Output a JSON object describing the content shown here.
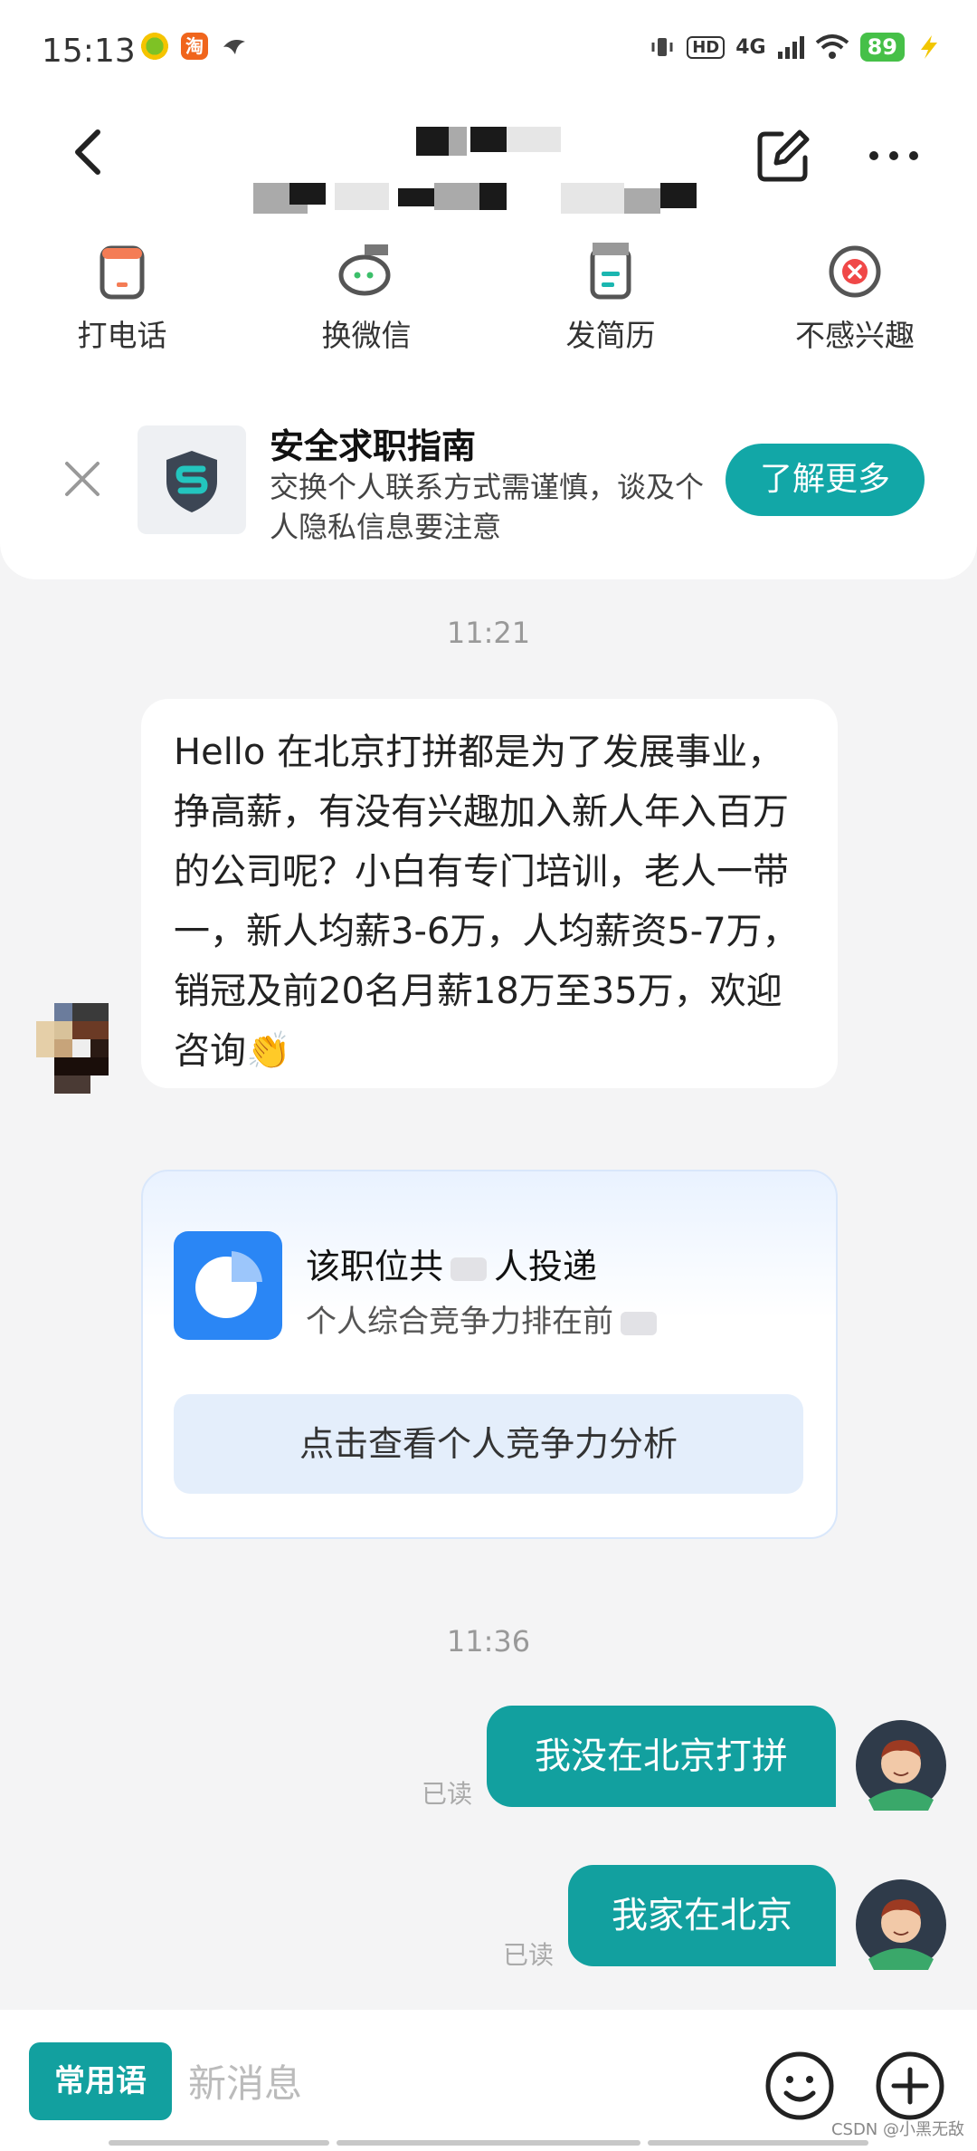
{
  "status": {
    "time": "15:13",
    "hd": "HD",
    "network": "4G",
    "battery": "89"
  },
  "apps": {
    "taobao": "淘"
  },
  "actions": [
    {
      "label": "打电话"
    },
    {
      "label": "换微信"
    },
    {
      "label": "发简历"
    },
    {
      "label": "不感兴趣"
    }
  ],
  "guide": {
    "title": "安全求职指南",
    "text": "交换个人联系方式需谨慎，谈及个人隐私信息要注意",
    "button": "了解更多"
  },
  "chat": {
    "time1": "11:21",
    "incoming": "Hello 在北京打拼都是为了发展事业，挣高薪，有没有兴趣加入新人年入百万的公司呢？小白有专门培训，老人一带一，新人均薪3-6万，人均薪资5-7万，销冠及前20名月薪18万至35万，欢迎咨询👏",
    "card": {
      "title_prefix": "该职位共",
      "title_suffix": "人投递",
      "sub": "个人综合竞争力排在前",
      "button": "点击查看个人竞争力分析"
    },
    "time2": "11:36",
    "outgoing": [
      {
        "text": "我没在北京打拼",
        "status": "已读"
      },
      {
        "text": "我家在北京",
        "status": "已读"
      }
    ]
  },
  "input": {
    "common_label": "常用语",
    "placeholder": "新消息"
  },
  "watermark": "CSDN @小黑无敌",
  "colors": {
    "accent": "#12a09f",
    "card_icon": "#2a86f5"
  }
}
